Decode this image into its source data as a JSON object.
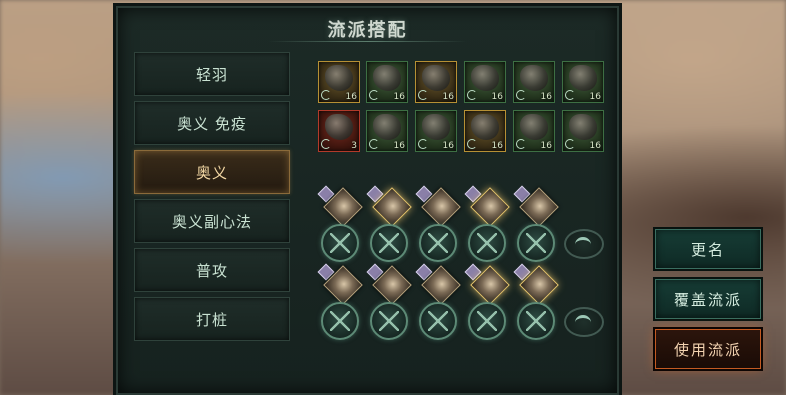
{
  "title": "流派搭配",
  "tabs": [
    {
      "label": "轻羽",
      "active": false
    },
    {
      "label": "奥义 免疫",
      "active": false
    },
    {
      "label": "奥义",
      "active": true
    },
    {
      "label": "奥义副心法",
      "active": false
    },
    {
      "label": "普攻",
      "active": false
    },
    {
      "label": "打桩",
      "active": false
    }
  ],
  "equipment": {
    "row1": [
      {
        "level": "16",
        "frame": "gold",
        "icon": "blade-weapon-icon"
      },
      {
        "level": "16",
        "frame": "green",
        "icon": "gauntlet-icon"
      },
      {
        "level": "16",
        "frame": "gold",
        "icon": "helmet-icon"
      },
      {
        "level": "16",
        "frame": "green",
        "icon": "cloak-icon"
      },
      {
        "level": "16",
        "frame": "green",
        "icon": "armor-icon"
      },
      {
        "level": "16",
        "frame": "green",
        "icon": "amulet-icon"
      }
    ],
    "row2": [
      {
        "level": "3",
        "frame": "red",
        "icon": "hooded-figure-icon"
      },
      {
        "level": "16",
        "frame": "green",
        "icon": "robe-icon"
      },
      {
        "level": "16",
        "frame": "green",
        "icon": "bracer-icon"
      },
      {
        "level": "16",
        "frame": "gold",
        "icon": "necklace-icon"
      },
      {
        "level": "16",
        "frame": "green",
        "icon": "boots-icon"
      },
      {
        "level": "16",
        "frame": "green",
        "icon": "ornament-icon"
      }
    ]
  },
  "buttons": {
    "rename": "更名",
    "overwrite": "覆盖流派",
    "use": "使用流派"
  },
  "colors": {
    "accent_active": "#f3d8a4",
    "use_button_border": "#c45a22",
    "panel_bg": "#1c2a26"
  }
}
